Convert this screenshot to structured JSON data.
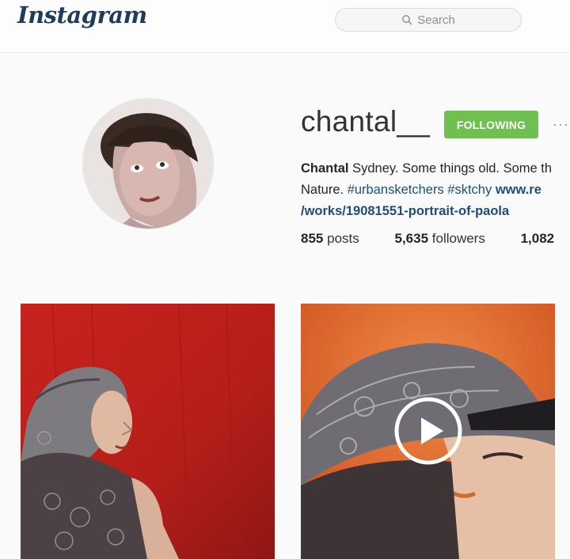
{
  "header": {
    "logo": "Instagram",
    "search_placeholder": "Search"
  },
  "profile": {
    "username": "chantal__",
    "follow_button": "FOLLOWING",
    "more_options": "···",
    "bio_name": "Chantal",
    "bio_text_1": "Sydney. Some things old. Some th",
    "bio_text_2": "Nature.",
    "hashtags": [
      "#urbansketchers",
      "#sktchy"
    ],
    "website_1": "www.re",
    "website_2": "/works/19081551-portrait-of-paola",
    "stats": {
      "posts_count": "855",
      "posts_label": "posts",
      "followers_count": "5,635",
      "followers_label": "followers",
      "following_count": "1,082"
    }
  },
  "posts": [
    {
      "type": "image",
      "description_icon": "painting-woman-headscarf-red"
    },
    {
      "type": "video",
      "description_icon": "painting-woman-headscarf-orange",
      "overlay_icon": "play-icon"
    }
  ],
  "colors": {
    "follow_green": "#70c050",
    "link_blue": "#1d4e7a",
    "logo_navy": "#1f3c5a"
  }
}
